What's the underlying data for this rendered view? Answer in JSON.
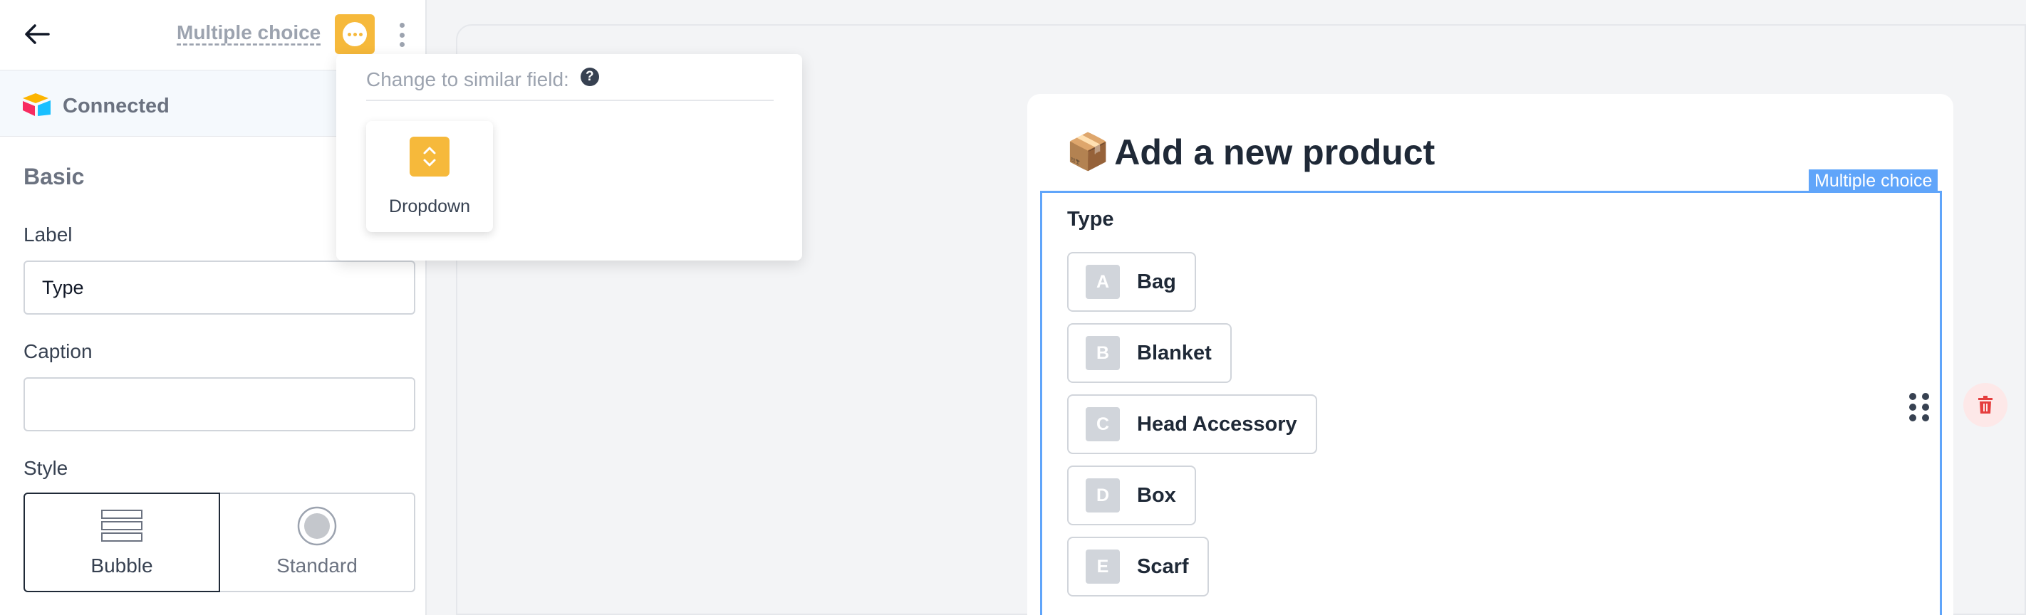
{
  "header": {
    "field_type": "Multiple choice"
  },
  "connection": {
    "status": "Connected"
  },
  "sidebar": {
    "section_title": "Basic",
    "label_field": {
      "label": "Label",
      "value": "Type"
    },
    "caption_field": {
      "label": "Caption",
      "value": ""
    },
    "style": {
      "label": "Style",
      "options": [
        {
          "label": "Bubble",
          "selected": true
        },
        {
          "label": "Standard",
          "selected": false
        }
      ]
    }
  },
  "popover": {
    "title": "Change to similar field:",
    "help": "?",
    "options": [
      {
        "label": "Dropdown"
      }
    ]
  },
  "form": {
    "emoji": "📦",
    "title": "Add a new product",
    "field_tag": "Multiple choice",
    "question": "Type",
    "choices": [
      {
        "key": "A",
        "label": "Bag"
      },
      {
        "key": "B",
        "label": "Blanket"
      },
      {
        "key": "C",
        "label": "Head Accessory"
      },
      {
        "key": "D",
        "label": "Box"
      },
      {
        "key": "E",
        "label": "Scarf"
      }
    ]
  },
  "colors": {
    "accent_yellow": "#f6b93b",
    "selection_blue": "#60a5fa",
    "delete_red": "#e53e3e"
  }
}
